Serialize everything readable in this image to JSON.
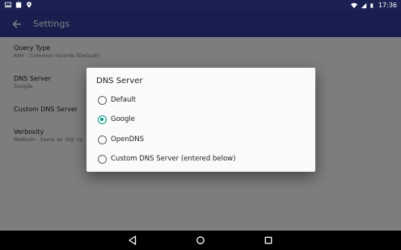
{
  "status_bar": {
    "time": "17:36",
    "left_icons": [
      "image-icon",
      "clipboard-icon",
      "location-pin-icon"
    ],
    "right_icons": [
      "wifi-icon",
      "signal-icon",
      "battery-icon"
    ]
  },
  "app_bar": {
    "title": "Settings",
    "back_icon": "arrow-back-icon"
  },
  "preferences": [
    {
      "title": "Query Type",
      "summary": "ANY - Common records (Default)"
    },
    {
      "title": "DNS Server",
      "summary": "Google"
    },
    {
      "title": "Custom DNS Server",
      "summary": ""
    },
    {
      "title": "Verbosity",
      "summary": "Medium - Same as 'dig' co"
    }
  ],
  "dialog": {
    "title": "DNS Server",
    "options": [
      {
        "label": "Default",
        "checked": false
      },
      {
        "label": "Google",
        "checked": true
      },
      {
        "label": "OpenDNS",
        "checked": false
      },
      {
        "label": "Custom DNS Server (entered below)",
        "checked": false
      }
    ]
  },
  "nav_bar": {
    "buttons": [
      "back-triangle-icon",
      "home-circle-icon",
      "recents-square-icon"
    ]
  },
  "colors": {
    "status_bar": "#1b2152",
    "app_bar": "#303f9f",
    "accent": "#009688",
    "scrim": "rgba(0,0,0,0.5)"
  }
}
